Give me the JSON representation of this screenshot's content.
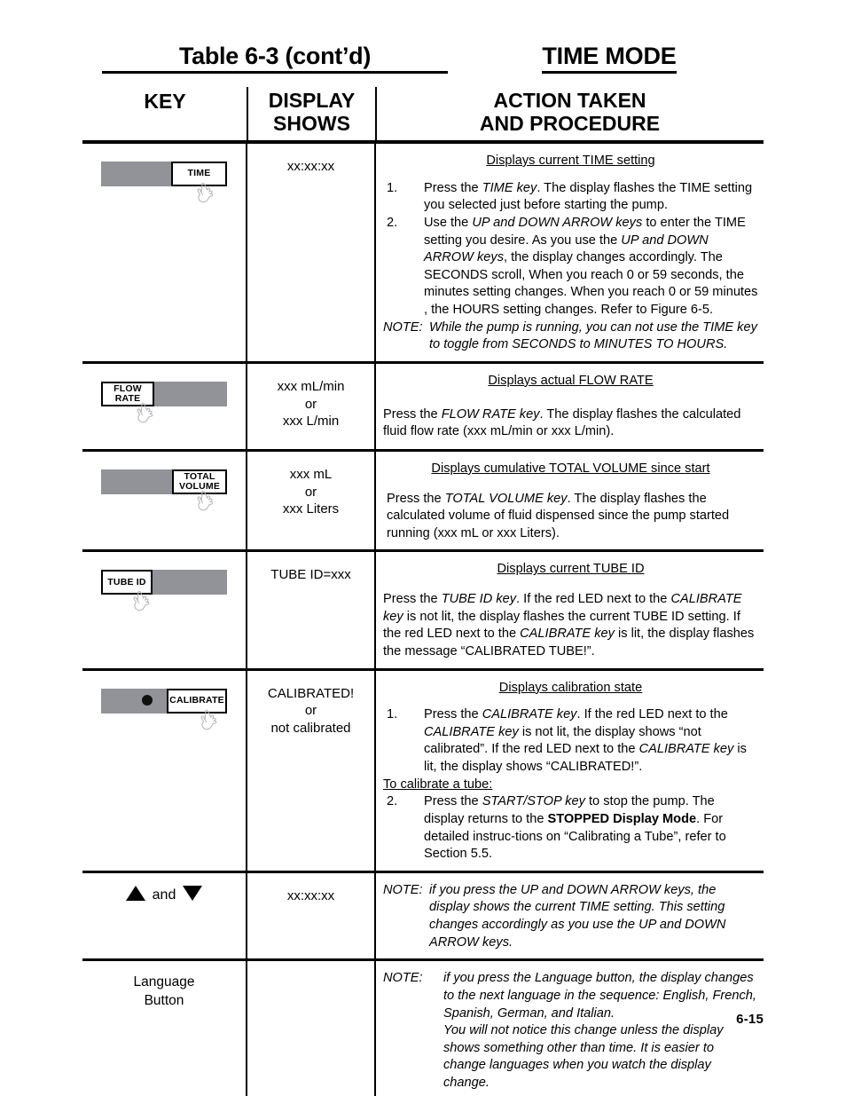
{
  "document": {
    "title_main": "Table 6-3 (cont’d)",
    "title_mode": "TIME MODE",
    "page_number": "6-15"
  },
  "columns": {
    "key": "KEY",
    "display_line1": "DISPLAY",
    "display_line2": "SHOWS",
    "action_line1": "ACTION TAKEN",
    "action_line2": "AND PROCEDURE"
  },
  "colors": {
    "key_gray": "#919398",
    "led": "#111111",
    "rule": "#000000"
  },
  "rows": [
    {
      "key": {
        "label": "TIME",
        "label_side": "right",
        "has_led": false,
        "icon": "pointing-hand-icon"
      },
      "display": [
        "xx:xx:xx"
      ],
      "action": {
        "heading": "Displays current TIME setting",
        "items": [
          {
            "num": "1.",
            "text": "Press the TIME key.  The display flashes the TIME setting you selected just before starting the pump."
          },
          {
            "num": "2.",
            "text": "Use the UP and DOWN ARROW keys to enter the TIME setting you desire.  As you use the UP and DOWN ARROW keys, the display changes accordingly.  The SECONDS scroll, When you reach 0 or 59 seconds, the minutes setting changes. When you reach 0 or 59 minutes , the HOURS setting changes.  Refer to Figure 6-5."
          }
        ],
        "note_label": "NOTE:",
        "note_text": "While the pump is running, you can not use the TIME key to toggle from SECONDS to MINUTES TO HOURS."
      }
    },
    {
      "key": {
        "label": "FLOW RATE",
        "label_side": "left",
        "has_led": false,
        "icon": "pointing-hand-icon"
      },
      "display": [
        "xxx mL/min",
        "or",
        "xxx L/min"
      ],
      "action": {
        "heading": "Displays actual FLOW RATE",
        "paragraph": "Press the FLOW RATE key.  The display flashes the calculated fluid flow rate (xxx mL/min or xxx L/min)."
      }
    },
    {
      "key": {
        "label": "TOTAL VOLUME",
        "label_side": "right",
        "has_led": false,
        "icon": "pointing-hand-icon"
      },
      "display": [
        "xxx mL",
        "or",
        "xxx Liters"
      ],
      "action": {
        "heading": "Displays cumulative TOTAL VOLUME since start",
        "paragraph": "Press the TOTAL VOLUME key.  The display flashes the calculated volume of fluid dispensed since the pump started running (xxx mL or xxx Liters)."
      }
    },
    {
      "key": {
        "label": "TUBE ID",
        "label_side": "left",
        "has_led": false,
        "icon": "pointing-hand-icon"
      },
      "display": [
        "TUBE ID=xxx"
      ],
      "action": {
        "heading": "Displays current TUBE ID",
        "paragraph": "Press the TUBE ID key.  If the red LED next to the CALIBRATE key is not lit, the display flashes the current TUBE ID setting.  If the red LED next to the CALIBRATE key is lit, the display flashes the message “CALIBRATED TUBE!”."
      }
    },
    {
      "key": {
        "label": "CALIBRATE",
        "label_side": "right",
        "has_led": true,
        "icon": "pointing-hand-icon"
      },
      "display": [
        "CALIBRATED!",
        "or",
        "not calibrated"
      ],
      "action": {
        "heading": "Displays calibration state",
        "items": [
          {
            "num": "1.",
            "text": "Press the CALIBRATE key.  If the red LED next to the CALIBRATE key is not lit, the display shows “not calibrated”. If the red LED next to the CALIBRATE key is lit, the display shows “CALIBRATED!”."
          }
        ],
        "subheading": "To calibrate a tube:",
        "items2": [
          {
            "num": "2.",
            "text": "Press the START/STOP key to stop the pump.  The display returns to the STOPPED Display Mode.  For detailed instructions on “Calibrating a Tube”, refer to Section 5.5."
          }
        ]
      }
    },
    {
      "key": {
        "arrows": "▲ and ▼",
        "and_text": "and",
        "icon_up": "arrow-up-icon",
        "icon_down": "arrow-down-icon"
      },
      "display": [
        "xx:xx:xx"
      ],
      "action": {
        "note_label": "NOTE:",
        "note_text": "if you press the UP and DOWN ARROW keys, the display shows the current TIME setting.  This setting changes accordingly as you use the UP and DOWN ARROW keys."
      }
    },
    {
      "key": {
        "text_line1": "Language",
        "text_line2": "Button"
      },
      "display": [],
      "action": {
        "note_label": "NOTE:",
        "note_text_1": "if you press the Language button, the display changes to the next language in the sequence: English, French, Spanish, German, and Italian.",
        "note_text_2": "You will not notice this change unless the display shows something other than time.  It is easier to change languages when you watch the display change."
      }
    }
  ]
}
